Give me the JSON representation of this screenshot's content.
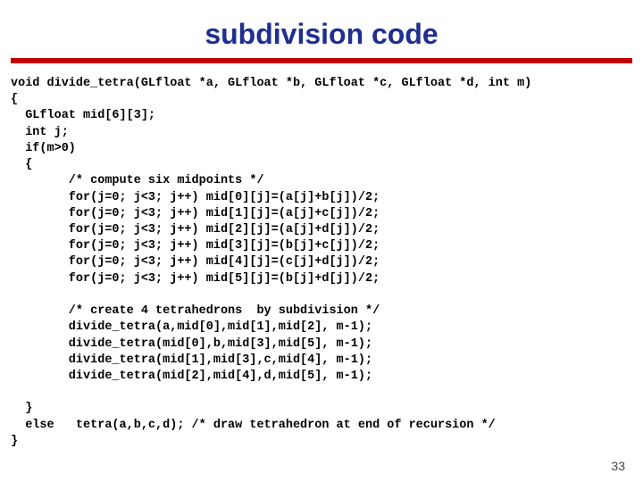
{
  "title": "subdivision code",
  "code": "void divide_tetra(GLfloat *a, GLfloat *b, GLfloat *c, GLfloat *d, int m)\n{\n  GLfloat mid[6][3];\n  int j;\n  if(m>0)\n  {\n        /* compute six midpoints */\n        for(j=0; j<3; j++) mid[0][j]=(a[j]+b[j])/2;\n        for(j=0; j<3; j++) mid[1][j]=(a[j]+c[j])/2;\n        for(j=0; j<3; j++) mid[2][j]=(a[j]+d[j])/2;\n        for(j=0; j<3; j++) mid[3][j]=(b[j]+c[j])/2;\n        for(j=0; j<3; j++) mid[4][j]=(c[j]+d[j])/2;\n        for(j=0; j<3; j++) mid[5][j]=(b[j]+d[j])/2;\n\n        /* create 4 tetrahedrons  by subdivision */\n        divide_tetra(a,mid[0],mid[1],mid[2], m-1);\n        divide_tetra(mid[0],b,mid[3],mid[5], m-1);\n        divide_tetra(mid[1],mid[3],c,mid[4], m-1);\n        divide_tetra(mid[2],mid[4],d,mid[5], m-1);\n\n  }\n  else   tetra(a,b,c,d); /* draw tetrahedron at end of recursion */\n}",
  "page_number": "33"
}
